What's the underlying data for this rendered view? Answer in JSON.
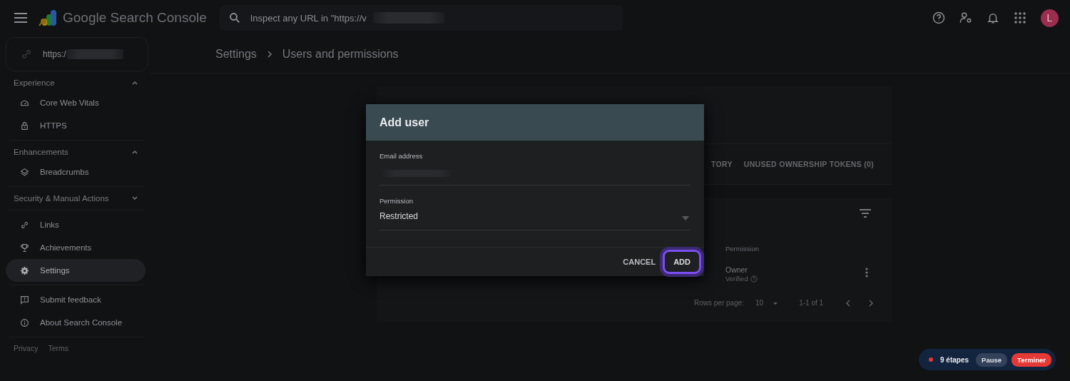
{
  "app_bar": {
    "title": "Google Search Console",
    "search": {
      "placeholder": "Inspect any URL in \"https://v"
    },
    "avatar": "L"
  },
  "property_selector": {
    "value": "https:/"
  },
  "sidebar": {
    "sections": [
      {
        "title": "Experience",
        "expanded": true,
        "items": [
          {
            "label": "Core Web Vitals",
            "selected": false
          },
          {
            "label": "HTTPS",
            "selected": false
          }
        ]
      },
      {
        "title": "Enhancements",
        "expanded": true,
        "items": [
          {
            "label": "Breadcrumbs",
            "selected": false
          }
        ]
      },
      {
        "title": "Security & Manual Actions",
        "expanded": false
      },
      {
        "items": [
          {
            "label": "Links",
            "selected": false
          },
          {
            "label": "Achievements",
            "selected": false
          },
          {
            "label": "Settings",
            "selected": true
          }
        ]
      },
      {
        "items": [
          {
            "label": "Submit feedback",
            "selected": false
          },
          {
            "label": "About Search Console",
            "selected": false
          }
        ]
      }
    ],
    "footer_links": [
      "Privacy",
      "Terms"
    ]
  },
  "breadcrumb": [
    "Settings",
    "Users and permissions"
  ],
  "tabs": [
    {
      "label": "TORY",
      "selected": false
    },
    {
      "label": "UNUSED OWNERSHIP TOKENS (0)",
      "selected": false
    }
  ],
  "users_table": {
    "columns": [
      "Permission"
    ],
    "rows": [
      {
        "permission": "Owner",
        "status": "Verified"
      }
    ],
    "rows_per_page_label": "Rows per page:",
    "rows_per_page": "10",
    "range": "1-1 of 1"
  },
  "dialog": {
    "title": "Add user",
    "fields": [
      {
        "kind": "text",
        "label": "Email address"
      },
      {
        "kind": "select",
        "label": "Permission",
        "value": "Restricted"
      }
    ],
    "buttons": [
      {
        "label": "CANCEL",
        "focused": false
      },
      {
        "label": "ADD",
        "focused": true
      }
    ]
  },
  "recorder": {
    "count": "9 étapes",
    "buttons": [
      {
        "label": "Pause",
        "kind": "secondary"
      },
      {
        "label": "Terminer",
        "kind": "danger"
      }
    ]
  }
}
